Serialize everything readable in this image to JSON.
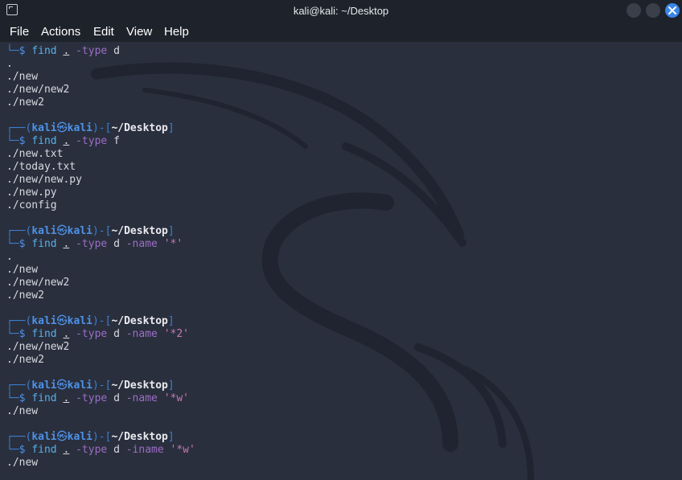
{
  "window": {
    "title": "kali@kali: ~/Desktop"
  },
  "menu": {
    "items": [
      "File",
      "Actions",
      "Edit",
      "View",
      "Help"
    ]
  },
  "prompt": {
    "user": "kali",
    "at": "㉿",
    "host": "kali",
    "path": "~/Desktop"
  },
  "terminal": {
    "blocks": [
      {
        "show_header": false,
        "command": {
          "name": "find",
          "dir": ".",
          "flag": "-type",
          "type": "d",
          "flag2": "",
          "pattern": ""
        },
        "output": [
          ".",
          "./new",
          "./new/new2",
          "./new2"
        ]
      },
      {
        "show_header": true,
        "command": {
          "name": "find",
          "dir": ".",
          "flag": "-type",
          "type": "f",
          "flag2": "",
          "pattern": ""
        },
        "output": [
          "./new.txt",
          "./today.txt",
          "./new/new.py",
          "./new.py",
          "./config"
        ]
      },
      {
        "show_header": true,
        "command": {
          "name": "find",
          "dir": ".",
          "flag": "-type",
          "type": "d",
          "flag2": "-name",
          "pattern": "'*'"
        },
        "output": [
          ".",
          "./new",
          "./new/new2",
          "./new2"
        ]
      },
      {
        "show_header": true,
        "command": {
          "name": "find",
          "dir": ".",
          "flag": "-type",
          "type": "d",
          "flag2": "-name",
          "pattern": "'*2'"
        },
        "output": [
          "./new/new2",
          "./new2"
        ]
      },
      {
        "show_header": true,
        "command": {
          "name": "find",
          "dir": ".",
          "flag": "-type",
          "type": "d",
          "flag2": "-name",
          "pattern": "'*w'"
        },
        "output": [
          "./new"
        ]
      },
      {
        "show_header": true,
        "command": {
          "name": "find",
          "dir": ".",
          "flag": "-type",
          "type": "d",
          "flag2": "-iname",
          "pattern": "'*w'"
        },
        "output": [
          "./new"
        ]
      }
    ]
  }
}
